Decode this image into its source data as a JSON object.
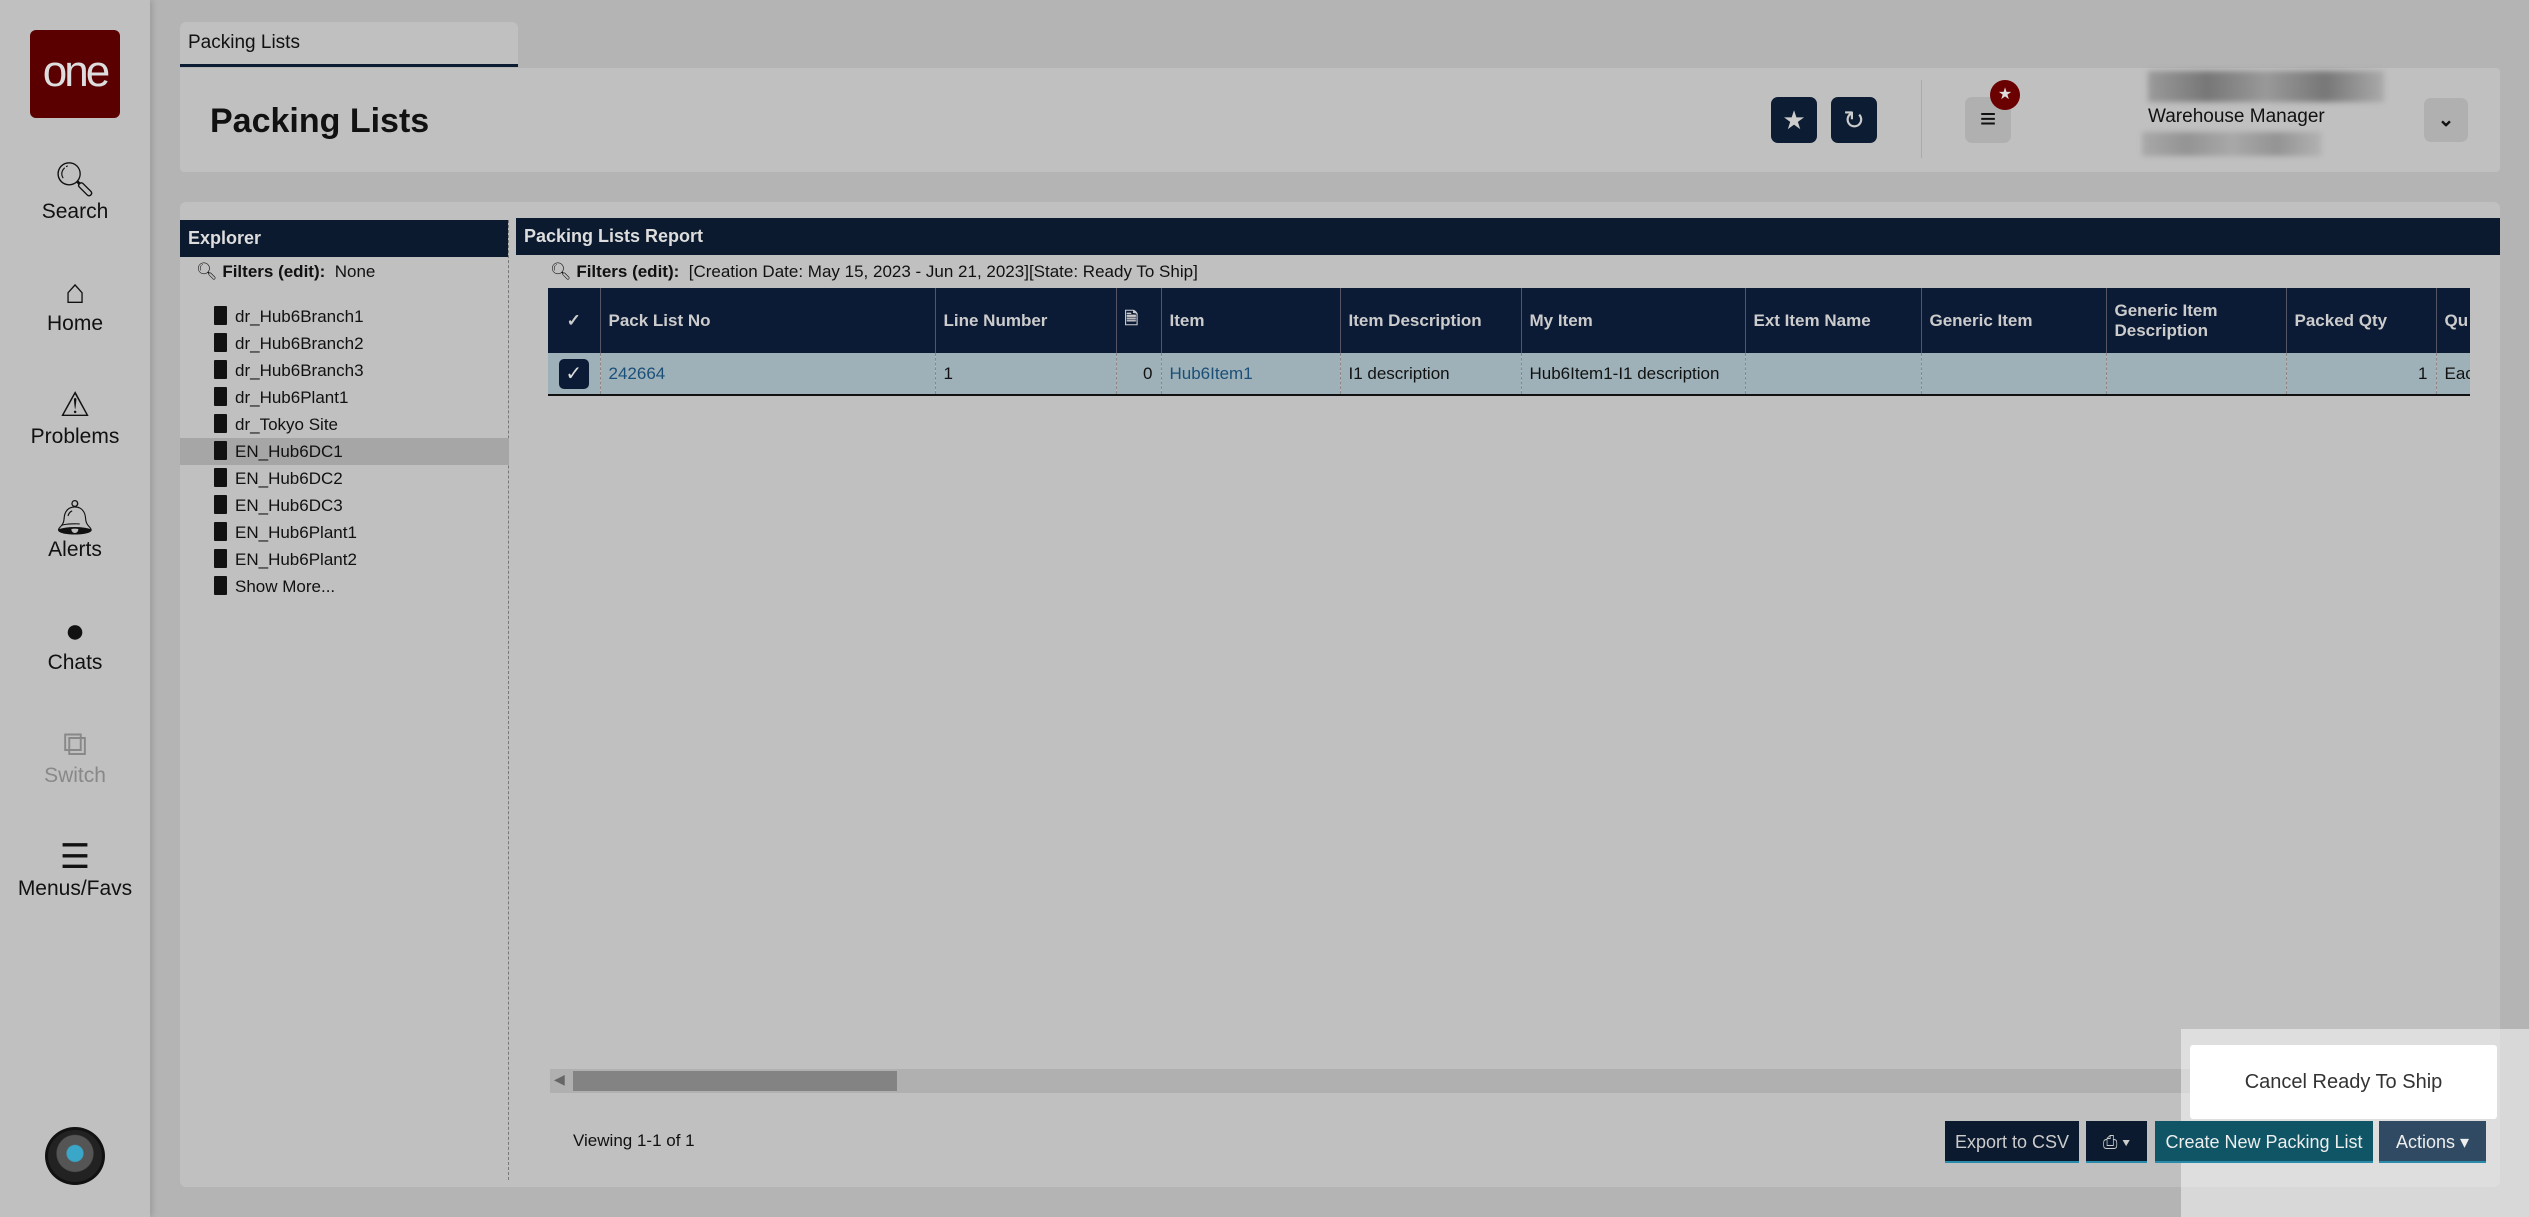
{
  "sidebar": {
    "logo": "one",
    "items": [
      {
        "label": "Search",
        "icon": "search-icon"
      },
      {
        "label": "Home",
        "icon": "home-icon"
      },
      {
        "label": "Problems",
        "icon": "warning-icon"
      },
      {
        "label": "Alerts",
        "icon": "bell-icon"
      },
      {
        "label": "Chats",
        "icon": "chat-icon"
      },
      {
        "label": "Switch",
        "icon": "switch-icon",
        "disabled": true
      },
      {
        "label": "Menus/Favs",
        "icon": "menu-icon"
      }
    ]
  },
  "tab": {
    "label": "Packing Lists"
  },
  "header": {
    "title": "Packing Lists",
    "role": "Warehouse Manager"
  },
  "explorer": {
    "title": "Explorer",
    "filters_label": "Filters (edit):",
    "filters_value": "None",
    "items": [
      "dr_Hub6Branch1",
      "dr_Hub6Branch2",
      "dr_Hub6Branch3",
      "dr_Hub6Plant1",
      "dr_Tokyo Site",
      "EN_Hub6DC1",
      "EN_Hub6DC2",
      "EN_Hub6DC3",
      "EN_Hub6Plant1",
      "EN_Hub6Plant2",
      "Show More..."
    ],
    "selected": "EN_Hub6DC1"
  },
  "report": {
    "title": "Packing Lists Report",
    "filters_label": "Filters (edit):",
    "filters_value": "[Creation Date: May 15, 2023 - Jun 21, 2023][State: Ready To Ship]",
    "columns": [
      "Pack List No",
      "Line Number",
      "",
      "Item",
      "Item Description",
      "My Item",
      "Ext Item Name",
      "Generic Item",
      "Generic Item Description",
      "Packed Qty",
      "Qu"
    ],
    "rows": [
      [
        "242664",
        "1",
        "0",
        "Hub6Item1",
        "I1 description",
        "Hub6Item1-I1 description",
        "",
        "",
        "",
        "1",
        "Eac"
      ]
    ]
  },
  "footer": {
    "viewing": "Viewing 1-1 of 1",
    "export": "Export to CSV",
    "create": "Create New Packing List",
    "actions": "Actions"
  },
  "popup": {
    "item": "Cancel Ready To Ship"
  }
}
